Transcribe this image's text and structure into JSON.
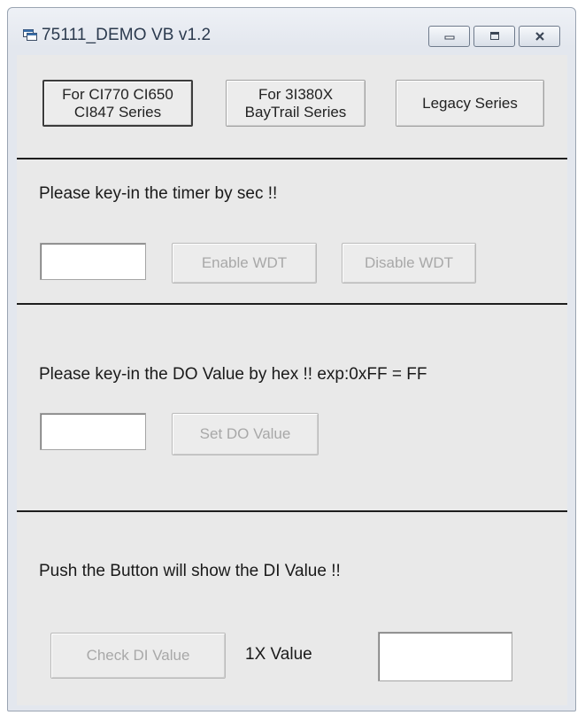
{
  "window": {
    "title": "75111_DEMO VB v1.2"
  },
  "series_buttons": {
    "ci770": "For CI770 CI650\nCI847 Series",
    "i380x": "For 3I380X\nBayTrail Series",
    "legacy": "Legacy Series"
  },
  "wdt": {
    "prompt": "Please key-in the timer by sec !!",
    "timer_value": "",
    "enable_label": "Enable WDT",
    "disable_label": "Disable WDT"
  },
  "do_section": {
    "prompt": "Please key-in the DO Value by hex !!  exp:0xFF = FF",
    "do_value": "",
    "set_label": "Set DO Value"
  },
  "di_section": {
    "prompt": "Push the Button will show the DI Value !!",
    "check_label": "Check DI Value",
    "value_label": "1X Value",
    "di_value": ""
  }
}
